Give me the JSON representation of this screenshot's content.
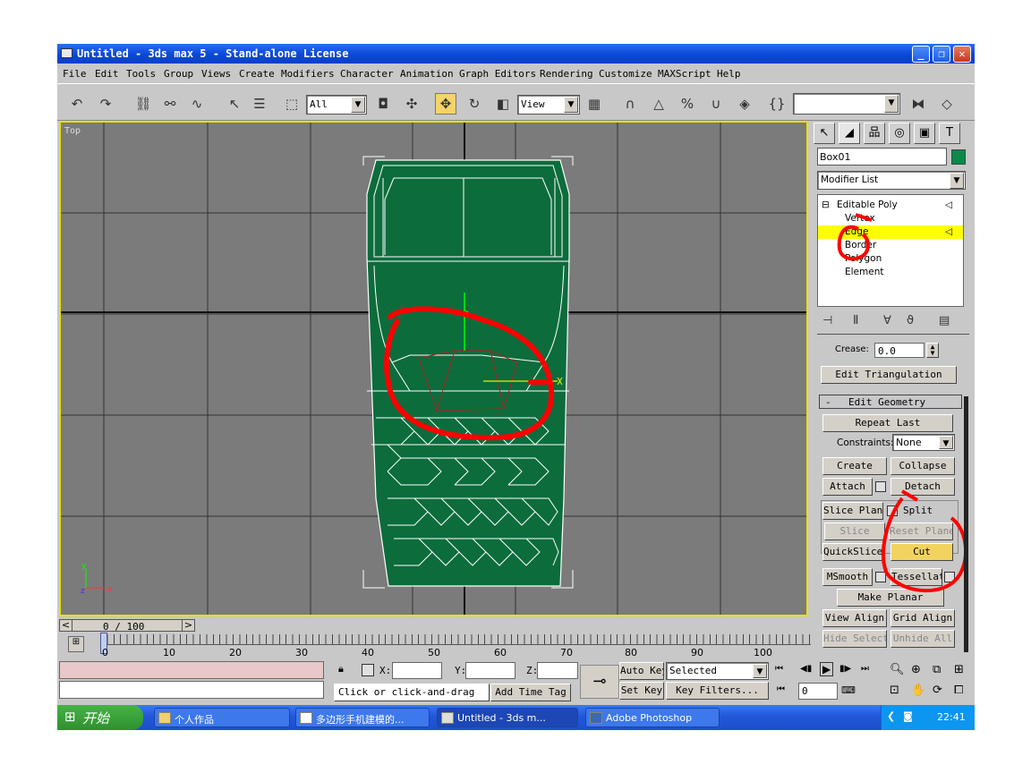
{
  "window": {
    "title": "Untitled - 3ds max 5 - Stand-alone License",
    "controls": [
      "_",
      "❐",
      "✕"
    ]
  },
  "menu": [
    "File",
    "Edit",
    "Tools",
    "Group",
    "Views",
    "Create",
    "Modifiers",
    "Character",
    "Animation",
    "Graph Editors",
    "Rendering",
    "Customize",
    "MAXScript",
    "Help"
  ],
  "toolbar": {
    "selection_filter": "All",
    "reference_coord": "View",
    "named_selection": ""
  },
  "viewport": {
    "label": "Top"
  },
  "command_panel": {
    "object_name": "Box01",
    "object_color": "#0a8a4a",
    "modifier_list": "Modifier List",
    "stack": {
      "root": "Editable Poly",
      "subobjects": [
        "Vertex",
        "Edge",
        "Border",
        "Polygon",
        "Element"
      ],
      "selected": "Edge"
    },
    "crease_label": "Crease:",
    "crease_value": "0.0",
    "edit_triangulation": "Edit Triangulation",
    "edit_geometry": {
      "title": "Edit Geometry",
      "collapse_sign": "-",
      "repeat_last": "Repeat Last",
      "constraints_label": "Constraints:",
      "constraints_value": "None",
      "create": "Create",
      "collapse": "Collapse",
      "attach": "Attach",
      "detach": "Detach",
      "slice_plane": "Slice Plane",
      "split": "Split",
      "slice": "Slice",
      "reset_plane": "Reset Plane",
      "quickslice": "QuickSlice",
      "cut": "Cut",
      "msmooth": "MSmooth",
      "tessellate": "Tessellate",
      "make_planar": "Make Planar",
      "view_align": "View Align",
      "grid_align": "Grid Align",
      "hide_selected": "Hide Selected",
      "unhide_all": "Unhide All"
    }
  },
  "timeline": {
    "frame": "0 / 100",
    "ticks": [
      "0",
      "10",
      "20",
      "30",
      "40",
      "50",
      "60",
      "70",
      "80",
      "90",
      "100"
    ]
  },
  "statusbar": {
    "x_label": "X:",
    "y_label": "Y:",
    "z_label": "Z:",
    "prompt": "Click or click-and-drag",
    "add_time_tag": "Add Time Tag",
    "auto_key": "Auto Key",
    "set_key": "Set Key",
    "key_mode": "Selected",
    "key_filters": "Key Filters...",
    "current_frame": "0"
  },
  "taskbar": {
    "start": "开始",
    "tasks": [
      "个人作品",
      "多边形手机建模的...",
      "Untitled - 3ds m...",
      "Adobe Photoshop"
    ],
    "clock": "22:41"
  }
}
